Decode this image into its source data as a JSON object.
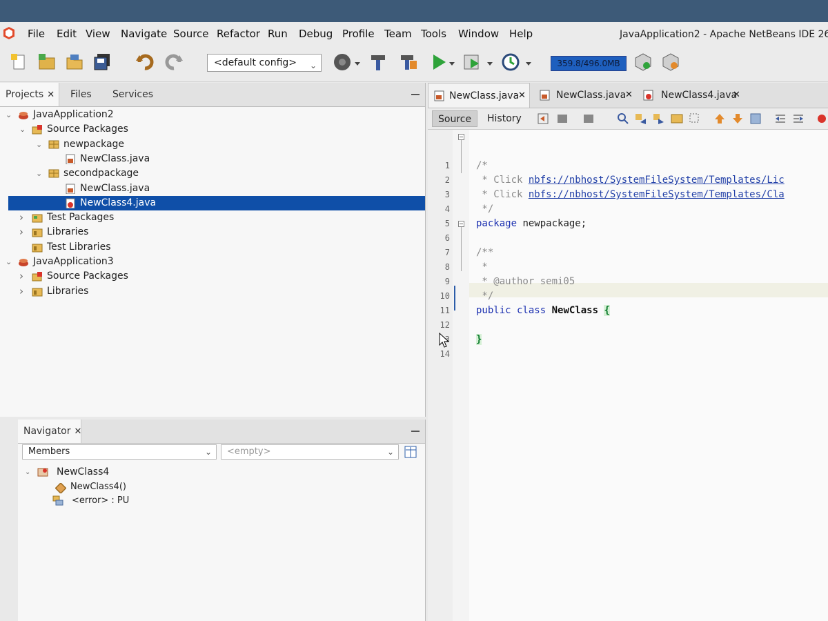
{
  "menubar": {
    "items": [
      "File",
      "Edit",
      "View",
      "Navigate",
      "Source",
      "Refactor",
      "Run",
      "Debug",
      "Profile",
      "Team",
      "Tools",
      "Window",
      "Help"
    ],
    "window_title": "JavaApplication2 - Apache NetBeans IDE 26"
  },
  "toolbar": {
    "config_value": "<default config>",
    "memory": "359.8/496.0MB",
    "icons": [
      "new-file-icon",
      "new-project-icon",
      "open-project-icon",
      "save-all-icon",
      "undo-icon",
      "redo-icon",
      "globe-icon",
      "build-icon",
      "clean-build-icon",
      "run-icon",
      "debug-icon",
      "profile-icon",
      "gc-icon",
      "pause-gc-icon"
    ]
  },
  "projects_panel": {
    "tabs": [
      {
        "label": "Projects",
        "closable": true
      },
      {
        "label": "Files",
        "closable": false
      },
      {
        "label": "Services",
        "closable": false
      }
    ],
    "tree": [
      {
        "label": "JavaApplication2",
        "icon": "project-icon",
        "expanded": true,
        "level": 0,
        "selected": false
      },
      {
        "label": "Source Packages",
        "icon": "source-packages-icon",
        "expanded": true,
        "level": 1,
        "selected": false
      },
      {
        "label": "newpackage",
        "icon": "package-icon",
        "expanded": true,
        "level": 2,
        "selected": false
      },
      {
        "label": "NewClass.java",
        "icon": "java-file-icon",
        "expanded": null,
        "level": 3,
        "selected": false
      },
      {
        "label": "secondpackage",
        "icon": "package-icon",
        "expanded": true,
        "level": 2,
        "selected": false
      },
      {
        "label": "NewClass.java",
        "icon": "java-file-icon",
        "expanded": null,
        "level": 3,
        "selected": false
      },
      {
        "label": "NewClass4.java",
        "icon": "java-file-error-icon",
        "expanded": null,
        "level": 3,
        "selected": true
      },
      {
        "label": "Test Packages",
        "icon": "test-packages-icon",
        "expanded": false,
        "level": 1,
        "selected": false
      },
      {
        "label": "Libraries",
        "icon": "libraries-icon",
        "expanded": false,
        "level": 1,
        "selected": false
      },
      {
        "label": "Test Libraries",
        "icon": "libraries-icon",
        "expanded": null,
        "level": 1,
        "selected": false
      },
      {
        "label": "JavaApplication3",
        "icon": "project-icon",
        "expanded": true,
        "level": 0,
        "selected": false
      },
      {
        "label": "Source Packages",
        "icon": "source-packages-icon",
        "expanded": false,
        "level": 1,
        "selected": false
      },
      {
        "label": "Libraries",
        "icon": "libraries-icon",
        "expanded": false,
        "level": 1,
        "selected": false
      }
    ]
  },
  "navigator": {
    "tab_label": "Navigator",
    "members_filter": "Members",
    "second_filter": "<empty>",
    "tree": [
      {
        "label": "NewClass4",
        "icon": "class-icon",
        "level": 0
      },
      {
        "label": "NewClass4()",
        "icon": "constructor-icon",
        "level": 1
      },
      {
        "label": "<error> : PU",
        "icon": "field-icon",
        "level": 1
      }
    ]
  },
  "editor": {
    "tabs": [
      {
        "label": "NewClass.java",
        "active": true,
        "icon": "java-file-icon"
      },
      {
        "label": "NewClass.java",
        "active": false,
        "icon": "java-file-icon"
      },
      {
        "label": "NewClass4.java",
        "active": false,
        "icon": "java-file-error-icon"
      }
    ],
    "view_tabs": [
      "Source",
      "History"
    ],
    "active_view": "Source",
    "line_numbers": [
      "1",
      "2",
      "3",
      "4",
      "5",
      "6",
      "7",
      "8",
      "9",
      "10",
      "11",
      "12",
      "13",
      "14"
    ],
    "code": {
      "l1": "/*",
      "l2_prefix": " * Click ",
      "l2_link": "nbfs://nbhost/SystemFileSystem/Templates/Lic",
      "l3_prefix": " * Click ",
      "l3_link": "nbfs://nbhost/SystemFileSystem/Templates/Cla",
      "l4": " */",
      "l5_kw": "package",
      "l5_rest": " newpackage;",
      "l7": "/**",
      "l8": " *",
      "l9": " * @author semi05",
      "l10": " */",
      "l11_kw": "public class",
      "l11_name": "NewClass",
      "l11_brace": "{",
      "l13_brace": "}"
    },
    "current_line": 11
  }
}
